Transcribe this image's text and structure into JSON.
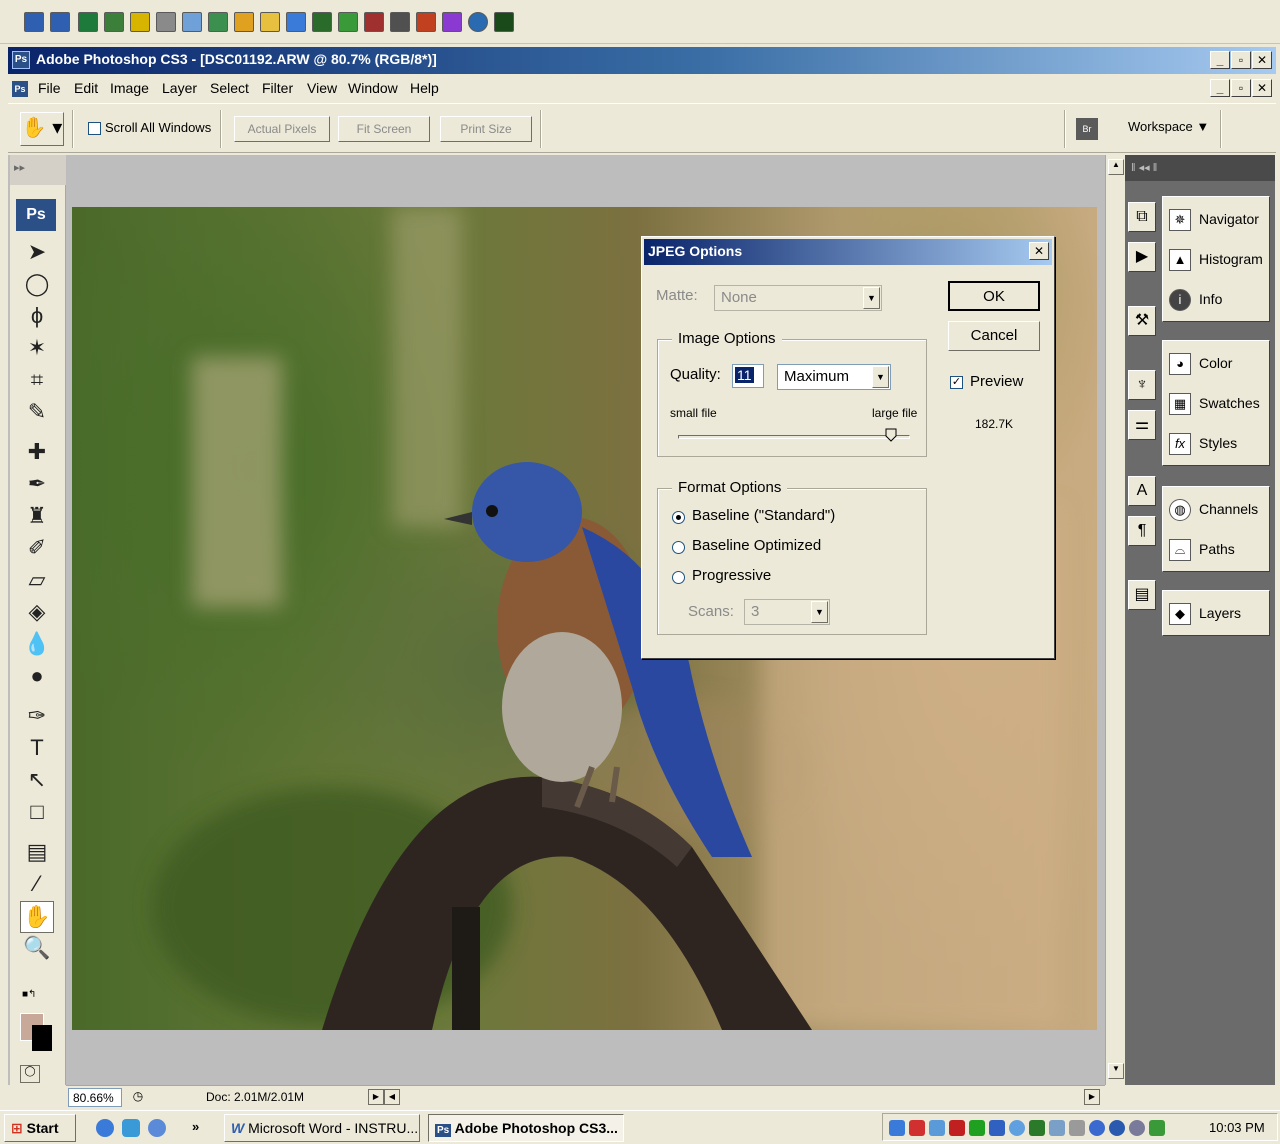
{
  "window": {
    "title": "Adobe Photoshop CS3 - [DSC01192.ARW @ 80.7% (RGB/8*)]",
    "app_badge": "Ps"
  },
  "menu": [
    "File",
    "Edit",
    "Image",
    "Layer",
    "Select",
    "Filter",
    "View",
    "Window",
    "Help"
  ],
  "options_bar": {
    "scroll_all_windows": "Scroll All Windows",
    "actual_pixels": "Actual Pixels",
    "fit_screen": "Fit Screen",
    "print_size": "Print Size",
    "workspace": "Workspace ▼"
  },
  "toolbox": {
    "logo": "Ps"
  },
  "dialog": {
    "title": "JPEG Options",
    "close": "✕",
    "matte_label": "Matte:",
    "matte_value": "None",
    "ok": "OK",
    "cancel": "Cancel",
    "preview_label": "Preview",
    "file_size": "182.7K",
    "image_options_title": "Image Options",
    "quality_label": "Quality:",
    "quality_value": "11",
    "quality_preset": "Maximum",
    "small_file": "small file",
    "large_file": "large file",
    "quality_slider_fraction": 0.92,
    "format_options_title": "Format Options",
    "baseline_standard": "Baseline (\"Standard\")",
    "baseline_optimized": "Baseline Optimized",
    "progressive": "Progressive",
    "scans_label": "Scans:",
    "scans_value": "3"
  },
  "panels": {
    "group1": [
      "Navigator",
      "Histogram",
      "Info"
    ],
    "group2": [
      "Color",
      "Swatches",
      "Styles"
    ],
    "group3": [
      "Channels",
      "Paths"
    ],
    "group4": [
      "Layers"
    ]
  },
  "status": {
    "zoom": "80.66%",
    "doc": "Doc: 2.01M/2.01M"
  },
  "taskbar": {
    "start": "Start",
    "chevron": "»",
    "word_task": "Microsoft Word - INSTRU...",
    "ps_task": "Adobe Photoshop CS3...",
    "clock": "10:03 PM"
  },
  "colors": {
    "title_gradient_start": "#0a246a",
    "title_gradient_end": "#a6caf0",
    "foreground_swatch": "#c8a898",
    "background_swatch": "#000000"
  }
}
